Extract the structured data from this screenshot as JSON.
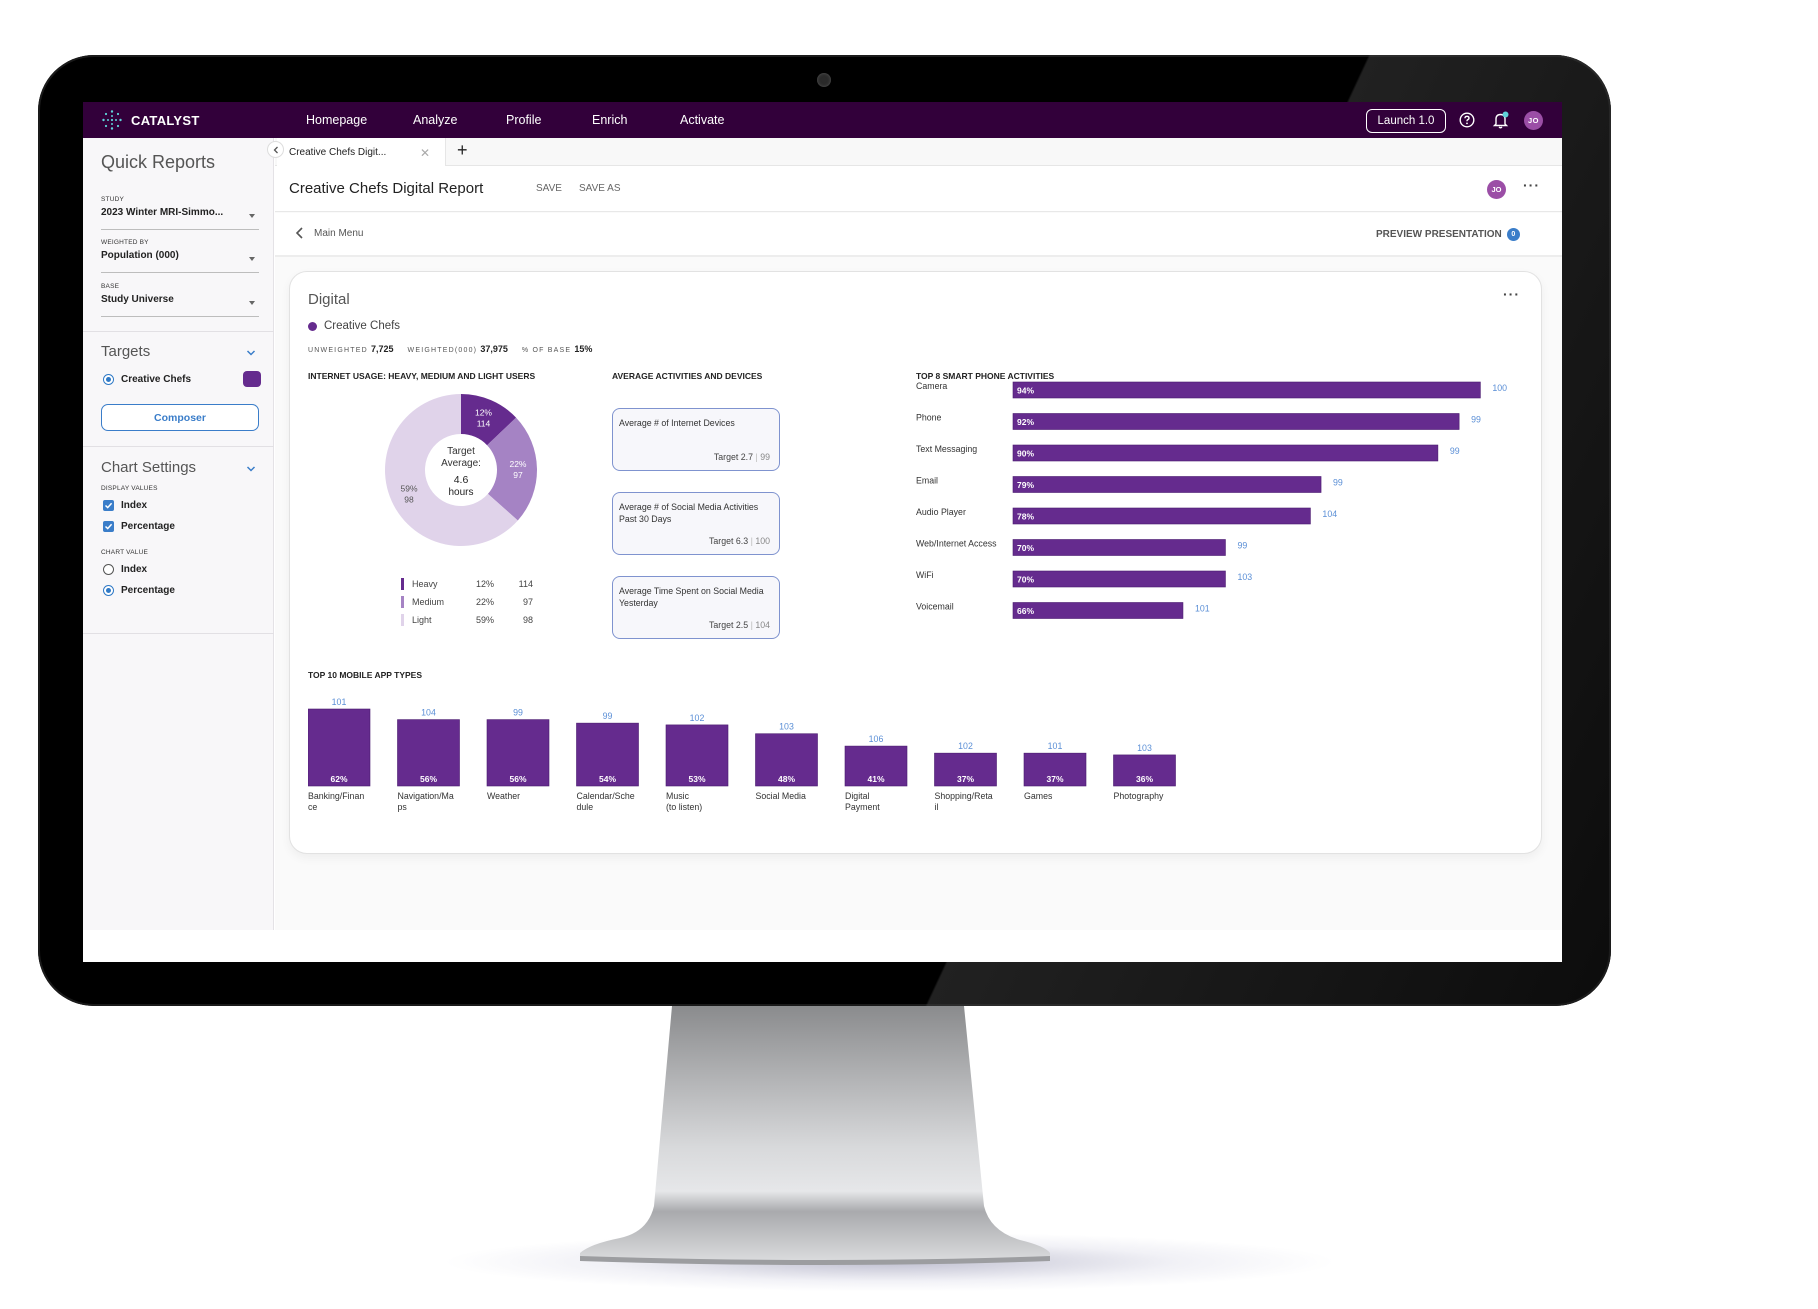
{
  "app": {
    "brand": "CATALYST",
    "nav": [
      "Homepage",
      "Analyze",
      "Profile",
      "Enrich",
      "Activate"
    ],
    "launch_label": "Launch 1.0",
    "user_initials": "JO",
    "colors": {
      "header": "#32003a",
      "accent": "#652b8e",
      "link": "#3a7dc9",
      "index_text": "#5b8fd6"
    }
  },
  "sidebar": {
    "title": "Quick Reports",
    "study": {
      "label": "STUDY",
      "value": "2023 Winter MRI-Simmo..."
    },
    "weighted_by": {
      "label": "WEIGHTED BY",
      "value": "Population (000)"
    },
    "base": {
      "label": "BASE",
      "value": "Study Universe"
    },
    "targets": {
      "title": "Targets",
      "items": [
        {
          "label": "Creative Chefs",
          "selected": true,
          "color": "#652b8e"
        }
      ],
      "composer_label": "Composer"
    },
    "chart_settings": {
      "title": "Chart Settings",
      "display_values_label": "DISPLAY VALUES",
      "display_values": [
        {
          "label": "Index",
          "checked": true
        },
        {
          "label": "Percentage",
          "checked": true
        }
      ],
      "chart_value_label": "CHART VALUE",
      "chart_value": [
        {
          "label": "Index",
          "selected": false
        },
        {
          "label": "Percentage",
          "selected": true
        }
      ]
    }
  },
  "tabs": [
    {
      "label": "Creative Chefs Digit...",
      "active": true
    }
  ],
  "report": {
    "title": "Creative Chefs Digital Report",
    "save_label": "SAVE",
    "save_as_label": "SAVE AS",
    "back_label": "Main Menu",
    "preview_label": "PREVIEW PRESENTATION",
    "preview_count": "0"
  },
  "card": {
    "title": "Digital",
    "target": "Creative Chefs",
    "stats": [
      {
        "label": "UNWEIGHTED",
        "value": "7,725"
      },
      {
        "label": "WEIGHTED(000)",
        "value": "37,975"
      },
      {
        "label": "% OF BASE",
        "value": "15%"
      }
    ],
    "activities_title": "AVERAGE ACTIVITIES AND DEVICES",
    "activities": [
      {
        "question": "Average # of Internet Devices",
        "target": "Target 2.7",
        "index": "99"
      },
      {
        "question": "Average # of Social Media Activities Past 30 Days",
        "target": "Target 6.3",
        "index": "100"
      },
      {
        "question": "Average Time Spent on Social Media Yesterday",
        "target": "Target 2.5",
        "index": "104"
      }
    ]
  },
  "chart_data": [
    {
      "type": "pie",
      "title": "INTERNET USAGE: HEAVY, MEDIUM AND LIGHT USERS",
      "center_label": [
        "Target",
        "Average:",
        "4.6",
        "hours"
      ],
      "categories": [
        "Heavy",
        "Medium",
        "Light"
      ],
      "values": [
        12,
        22,
        59
      ],
      "index": [
        114,
        97,
        98
      ],
      "colors": [
        "#652b8e",
        "#a583c4",
        "#e0d3ea"
      ],
      "legend": "bottom"
    },
    {
      "type": "bar",
      "orientation": "horizontal",
      "title": "TOP 8 SMART PHONE ACTIVITIES",
      "categories": [
        "Camera",
        "Phone",
        "Text Messaging",
        "Email",
        "Audio Player",
        "Web/Internet Access",
        "WiFi",
        "Voicemail"
      ],
      "values": [
        94,
        92,
        90,
        79,
        78,
        70,
        70,
        66
      ],
      "index": [
        100,
        99,
        99,
        99,
        104,
        99,
        103,
        101
      ],
      "value_suffix": "%",
      "xlim": [
        50,
        95
      ],
      "color": "#652b8e"
    },
    {
      "type": "bar",
      "orientation": "vertical",
      "title": "TOP 10 MOBILE APP TYPES",
      "categories": [
        "Banking/Finance",
        "Navigation/Maps",
        "Weather",
        "Calendar/Schedule",
        "Music (to listen)",
        "Social Media",
        "Digital Payment",
        "Shopping/Retail",
        "Games",
        "Photography"
      ],
      "values": [
        62,
        56,
        56,
        54,
        53,
        48,
        41,
        37,
        37,
        36
      ],
      "index": [
        101,
        104,
        99,
        99,
        102,
        103,
        106,
        102,
        101,
        103
      ],
      "value_suffix": "%",
      "color": "#652b8e"
    }
  ]
}
